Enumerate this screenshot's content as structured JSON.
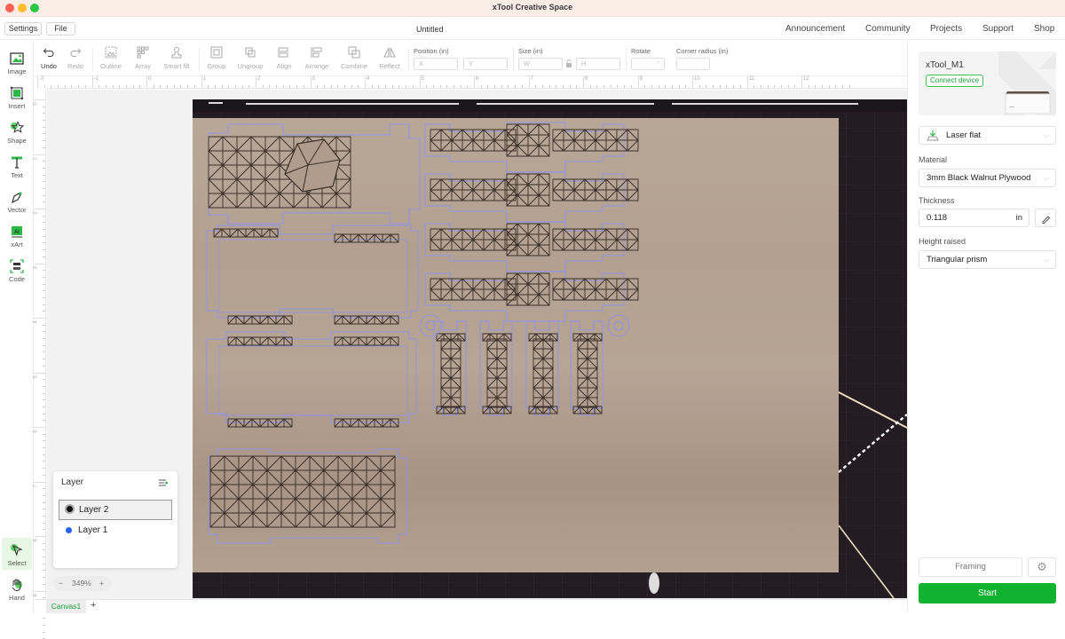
{
  "window": {
    "title": "xTool Creative Space",
    "document_title": "Untitled"
  },
  "menu": {
    "settings_label": "Settings",
    "file_label": "File"
  },
  "top_links": [
    "Announcement",
    "Community",
    "Projects",
    "Support",
    "Shop"
  ],
  "left_tools": [
    {
      "label": "Image",
      "icon": "image-icon"
    },
    {
      "label": "Insert",
      "icon": "insert-icon"
    },
    {
      "label": "Shape",
      "icon": "shape-icon"
    },
    {
      "label": "Text",
      "icon": "text-icon"
    },
    {
      "label": "Vector",
      "icon": "vector-pen-icon"
    },
    {
      "label": "xArt",
      "icon": "xart-icon"
    },
    {
      "label": "Code",
      "icon": "code-icon"
    }
  ],
  "bottom_tools": [
    {
      "label": "Select",
      "icon": "select-cursor-icon",
      "active": true
    },
    {
      "label": "Hand",
      "icon": "hand-icon",
      "active": false
    }
  ],
  "toolbar": {
    "undo": "Undo",
    "redo": "Redo",
    "outline": "Outline",
    "array": "Array",
    "smart_fill": "Smart fill",
    "group": "Group",
    "ungroup": "Ungroup",
    "align": "Align",
    "arrange": "Arrange",
    "combine": "Combine",
    "reflect": "Reflect",
    "position_label": "Position (in)",
    "x_placeholder": "X",
    "y_placeholder": "Y",
    "size_label": "Size (in)",
    "w_placeholder": "W",
    "h_placeholder": "H",
    "rotate_label": "Rotate",
    "rotate_unit": "°",
    "corner_radius_label": "Corner radius (in)"
  },
  "ruler": {
    "horizontal": [
      "-2",
      "-1",
      "0",
      "1",
      "2",
      "3",
      "4",
      "5",
      "6",
      "7",
      "8",
      "9",
      "10",
      "11",
      "12"
    ],
    "vertical": [
      "0",
      "1",
      "2",
      "3",
      "4",
      "5",
      "6",
      "7",
      "8",
      "9"
    ]
  },
  "device": {
    "name": "xTool_M1",
    "connect_label": "Connect device"
  },
  "settings_panel": {
    "mode": "Laser flat",
    "material_label": "Material",
    "material": "3mm Black Walnut Plywood",
    "thickness_label": "Thickness",
    "thickness": "0.118",
    "thickness_unit": "in",
    "height_raised_label": "Height raised",
    "height_raised": "Triangular prism",
    "framing_label": "Framing",
    "start_label": "Start"
  },
  "layers": {
    "title": "Layer",
    "items": [
      {
        "name": "Layer 2",
        "color": "#111111",
        "selected": true
      },
      {
        "name": "Layer 1",
        "color": "#2563eb",
        "selected": false
      }
    ]
  },
  "zoom": {
    "level": "349%",
    "minus": "−",
    "plus": "+"
  },
  "canvas_tabs": [
    {
      "label": "Canvas1"
    }
  ],
  "add_tab_label": "+",
  "colors": {
    "accent": "#10b22f",
    "outline": "#8a90ff",
    "engrave": "#3a2f28"
  }
}
